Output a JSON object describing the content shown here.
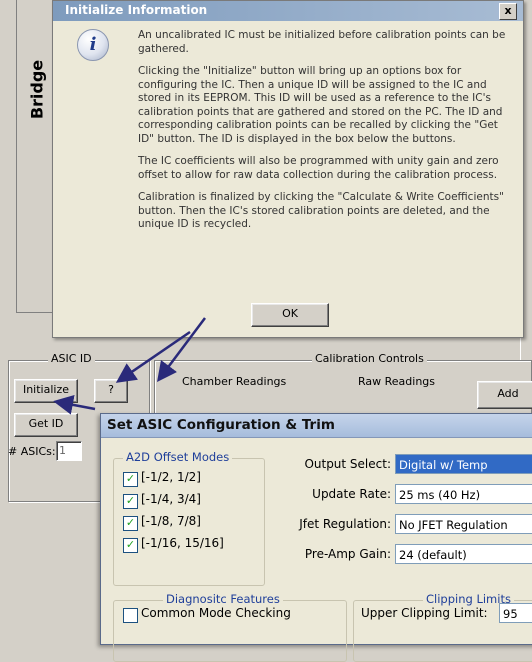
{
  "main": {
    "bridge_label": "Bridge",
    "asic_id": {
      "title": "ASIC ID",
      "initialize_label": "Initialize",
      "help_label": "?",
      "get_id_label": "Get ID",
      "asics_label": "# ASICs:",
      "asics_value": "1"
    },
    "calibration": {
      "title": "Calibration Controls",
      "chamber_readings": "Chamber Readings",
      "raw_readings": "Raw Readings",
      "add_label": "Add"
    }
  },
  "info_dialog": {
    "title": "Initialize Information",
    "close": "x",
    "paragraphs": [
      "An uncalibrated IC must be initialized before calibration points can be gathered.",
      "Clicking the \"Initialize\" button will bring up an options box for configuring the IC. Then a unique ID will be assigned to the IC and stored in its EEPROM. This ID will be used as a reference to the IC's calibration points that are gathered and stored on the PC. The ID and corresponding calibration points can be recalled by clicking the \"Get ID\" button. The ID is displayed in the box below the buttons.",
      "The IC coefficients will also be programmed with unity gain and zero offset to allow for raw data collection during the calibration process.",
      "Calibration is finalized by clicking the \"Calculate & Write Coefficients\" button. Then the IC's stored calibration points are deleted, and the unique ID is recycled."
    ],
    "ok_label": "OK"
  },
  "config_dialog": {
    "title": "Set ASIC Configuration & Trim",
    "a2d_group": {
      "title": "A2D Offset Modes",
      "options": [
        {
          "label": "[-1/2, 1/2]",
          "checked": true
        },
        {
          "label": "[-1/4, 3/4]",
          "checked": true
        },
        {
          "label": "[-1/8, 7/8]",
          "checked": true
        },
        {
          "label": "[-1/16, 15/16]",
          "checked": true
        }
      ]
    },
    "settings": {
      "output_select_label": "Output Select:",
      "output_select_value": "Digital w/ Temp",
      "update_rate_label": "Update Rate:",
      "update_rate_value": "25 ms (40 Hz)",
      "jfet_label": "Jfet Regulation:",
      "jfet_value": "No JFET Regulation",
      "preamp_label": "Pre-Amp Gain:",
      "preamp_value": "24 (default)"
    },
    "diagnostic": {
      "title": "Diagnositc Features",
      "common_mode_label": "Common Mode Checking",
      "common_mode_checked": false
    },
    "clipping": {
      "title": "Clipping Limits",
      "upper_label": "Upper Clipping Limit:",
      "upper_value": "95"
    }
  },
  "colors": {
    "accent_blue": "#1f3f9a",
    "arrow_navy": "#2a2a7a",
    "check_green": "#21a121"
  }
}
